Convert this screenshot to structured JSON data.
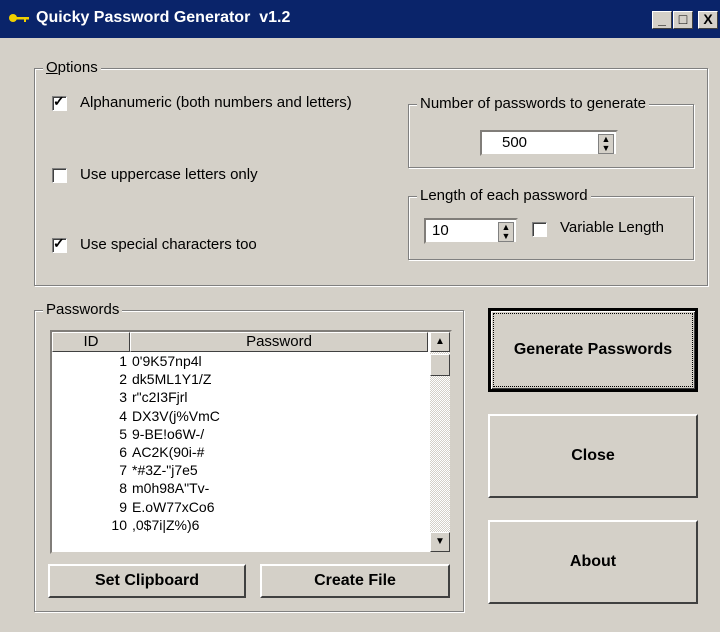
{
  "window": {
    "title": "Quicky Password Generator  v1.2",
    "minimize": "_",
    "maximize": "□",
    "close": "X"
  },
  "options": {
    "legend": "Options",
    "alphanumeric": {
      "label": "Alphanumeric (both numbers and letters)",
      "checked": true
    },
    "uppercase": {
      "label": "Use uppercase letters only",
      "checked": false
    },
    "special": {
      "label": "Use special characters too",
      "checked": true
    },
    "count_group": {
      "legend": "Number of passwords to generate",
      "value": "500"
    },
    "length_group": {
      "legend": "Length of each password",
      "value": "10",
      "variable_label": "Variable Length",
      "variable_checked": false
    }
  },
  "passwords": {
    "legend": "Passwords",
    "columns": [
      "ID",
      "Password"
    ],
    "rows": [
      {
        "id": "1",
        "pw": "0'9K57np4l"
      },
      {
        "id": "2",
        "pw": "dk5ML1Y1/Z"
      },
      {
        "id": "3",
        "pw": "r\"c2I3Fjrl"
      },
      {
        "id": "4",
        "pw": "DX3V(j%VmC"
      },
      {
        "id": "5",
        "pw": "9-BE!o6W-/"
      },
      {
        "id": "6",
        "pw": "AC2K(90i-#"
      },
      {
        "id": "7",
        "pw": "*#3Z-\"j7e5"
      },
      {
        "id": "8",
        "pw": "m0h98A\"Tv-"
      },
      {
        "id": "9",
        "pw": "E.oW77xCo6"
      },
      {
        "id": "10",
        "pw": ",0$7i|Z%)6"
      }
    ],
    "set_clipboard": "Set Clipboard",
    "create_file": "Create File"
  },
  "buttons": {
    "generate": "Generate Passwords",
    "close": "Close",
    "about": "About"
  }
}
